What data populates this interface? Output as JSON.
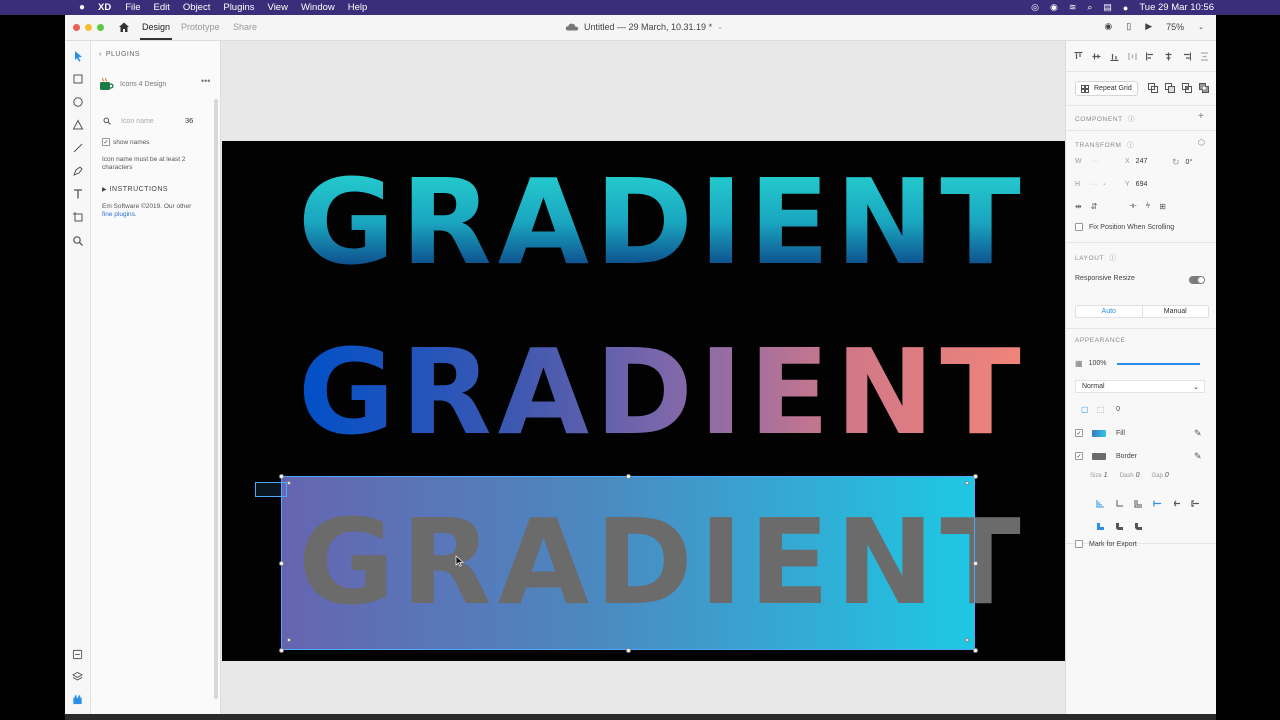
{
  "menubar": {
    "app": "XD",
    "items": [
      "File",
      "Edit",
      "Object",
      "Plugins",
      "View",
      "Window",
      "Help"
    ],
    "clock": "Tue 29 Mar  10:56"
  },
  "toolbar": {
    "tabs": [
      "Design",
      "Prototype",
      "Share"
    ],
    "active_tab": "Design",
    "doc_title": "Untitled — 29 March, 10.31.19 *",
    "zoom": "75%"
  },
  "plugin_panel": {
    "header": "PLUGINS",
    "plugin_name": "Icons 4 Design",
    "search_placeholder": "Icon name",
    "icon_count": "36",
    "show_names_label": "show names",
    "note": "Icon name must be at least 2 characters",
    "instructions_label": "INSTRUCTIONS",
    "credit_text": "Em Software ©2019. Our other",
    "credit_link": "fine plugins",
    "credit_end": "."
  },
  "canvas": {
    "words": [
      "GRADIENT",
      "GRADIENT",
      "GRADIENT"
    ]
  },
  "inspector": {
    "repeat_grid": "Repeat Grid",
    "component_label": "COMPONENT",
    "transform_label": "TRANSFORM",
    "w_label": "W",
    "x_label": "X",
    "x_value": "247",
    "rotation": "0°",
    "h_label": "H",
    "y_label": "Y",
    "y_value": "694",
    "fix_scroll": "Fix Position When Scrolling",
    "layout_label": "LAYOUT",
    "responsive": "Responsive Resize",
    "auto": "Auto",
    "manual": "Manual",
    "appearance_label": "APPEARANCE",
    "opacity": "100%",
    "blend_mode": "Normal",
    "corner_radius": "0",
    "fill_label": "Fill",
    "border_label": "Border",
    "size_label": "Size",
    "size_value": "1",
    "dash_label": "Dash",
    "dash_value": "0",
    "gap_label": "Gap",
    "gap_value": "0",
    "export_label": "Mark for Export"
  },
  "colors": {
    "accent": "#2c8ee8",
    "menubar": "#3a2e7a",
    "fill_swatch": "#4a90c8",
    "border_swatch": "#6b6b6b"
  }
}
